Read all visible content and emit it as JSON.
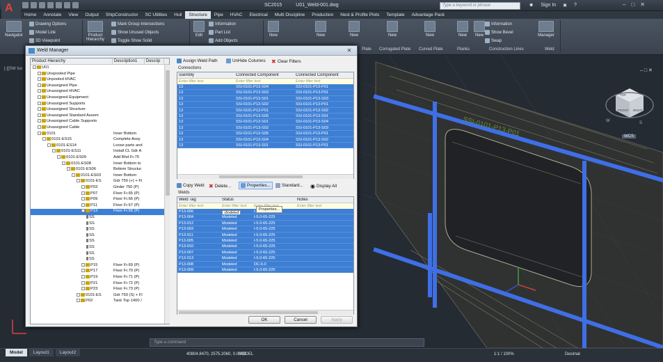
{
  "app": {
    "version_tab": "SC2015",
    "file_name": "U01_Weld-001.dwg",
    "search_placeholder": "Type a keyword or phrase",
    "sign_in": "Sign In"
  },
  "menu": [
    "Home",
    "Annotate",
    "View",
    "Output",
    "ShipConstructor",
    "SC Utilities",
    "Hull",
    "Structure",
    "Pipe",
    "HVAC",
    "Electrical",
    "Multi Discipline",
    "Production",
    "Nest & Profile Plots",
    "Template",
    "Advantage Pack"
  ],
  "menu_active_index": 7,
  "ribbon": {
    "navigator": "Navigator",
    "drawing_options": "Drawing Options",
    "model_link": "Model Link",
    "viewpoint_3d": "3D Viewpoint",
    "product": "Product",
    "hierarchy": "Hierarchy",
    "mark_group_intersections": "Mark Group Intersections",
    "show_unused_objects": "Show Unused Objects",
    "toggle_show_solid": "Toggle Show Solid",
    "edit": "Edit",
    "information": "Information",
    "part_list": "Part List",
    "add_objects": "Add Objects",
    "new": "New",
    "manager": "Manager",
    "information2": "Information",
    "show_bevel": "Show Bevel",
    "swap": "Swap",
    "panel_labels": [
      "Plate",
      "Corrugated Plate",
      "Curved Plate",
      "Planks",
      "Construction Lines",
      "Weld"
    ]
  },
  "status": {
    "tabs": [
      "Model",
      "Layout1",
      "Layout2"
    ],
    "command_placeholder": "Type a command",
    "coordinates": "40804.8470, 2575.2060, 0.0000",
    "model": "MODEL",
    "scale": "1:1 / 100%",
    "units": "Decimal"
  },
  "viewport": {
    "label": "[-][SW Iso",
    "compass_top": "TOP",
    "compass_right": "RIGHT",
    "compass_front": "FRONT",
    "compass_s": "S",
    "compass_w": "W",
    "wcs": "WCS"
  },
  "dialog": {
    "title": "Weld Manager",
    "tree_columns": [
      "Product Hierarchy",
      "Description1",
      "Descrip"
    ],
    "tree": [
      {
        "indent": 0,
        "icon": "node",
        "name": "U01",
        "desc": "",
        "sel": false
      },
      {
        "indent": 1,
        "icon": "node",
        "name": "Unspooled Pipe",
        "desc": "",
        "sel": false
      },
      {
        "indent": 1,
        "icon": "node",
        "name": "Unpooled HVAC",
        "desc": "",
        "sel": false
      },
      {
        "indent": 1,
        "icon": "node",
        "name": "Unassigned Pipe",
        "desc": "",
        "sel": false
      },
      {
        "indent": 1,
        "icon": "node",
        "name": "Unassigned HVAC",
        "desc": "",
        "sel": false
      },
      {
        "indent": 1,
        "icon": "node",
        "name": "Unassigned Equipment",
        "desc": "",
        "sel": false
      },
      {
        "indent": 1,
        "icon": "node",
        "name": "Unassigned Supports",
        "desc": "",
        "sel": false
      },
      {
        "indent": 1,
        "icon": "node",
        "name": "Unassigned Structure",
        "desc": "",
        "sel": false
      },
      {
        "indent": 1,
        "icon": "node",
        "name": "Unassigned Standard Assem",
        "desc": "",
        "sel": false
      },
      {
        "indent": 1,
        "icon": "node",
        "name": "Unassigned Cable Supports",
        "desc": "",
        "sel": false
      },
      {
        "indent": 1,
        "icon": "node",
        "name": "Unassigned Cable",
        "desc": "",
        "sel": false
      },
      {
        "indent": 1,
        "icon": "node",
        "name": "0101",
        "desc": "Inner Bottom",
        "sel": false
      },
      {
        "indent": 2,
        "icon": "node",
        "name": "0101-ES15",
        "desc": "Complete Assy",
        "sel": false
      },
      {
        "indent": 3,
        "icon": "node",
        "name": "0101-ES14",
        "desc": "Loose parts and",
        "sel": false
      },
      {
        "indent": 4,
        "icon": "node",
        "name": "0101-ES11",
        "desc": "Install CL Gdr A",
        "sel": false
      },
      {
        "indent": 5,
        "icon": "node",
        "name": "0101-ES09",
        "desc": "Add Bhd Fr.75",
        "sel": false
      },
      {
        "indent": 6,
        "icon": "node",
        "name": "0101-ES08",
        "desc": "Inner Bottom to",
        "sel": false
      },
      {
        "indent": 7,
        "icon": "node",
        "name": "0101-ES06",
        "desc": "Bottom Structur",
        "sel": false
      },
      {
        "indent": 8,
        "icon": "node",
        "name": "0101-ES03",
        "desc": "Inner Bottom",
        "sel": false
      },
      {
        "indent": 9,
        "icon": "node",
        "name": "0101-ES",
        "desc": "Gdr 750 (+) + Fl",
        "sel": false
      },
      {
        "indent": 10,
        "icon": "node",
        "name": "P03",
        "desc": "Girder 750 (P)",
        "sel": false
      },
      {
        "indent": 10,
        "icon": "node",
        "name": "P07",
        "desc": "Floor Fr.65 (P)",
        "sel": false
      },
      {
        "indent": 10,
        "icon": "node",
        "name": "P09",
        "desc": "Floor Fr.66 (P)",
        "sel": false
      },
      {
        "indent": 10,
        "icon": "node",
        "name": "P11",
        "desc": "Floor Fr.67 (P)",
        "sel": false
      },
      {
        "indent": 10,
        "icon": "node",
        "name": "P13",
        "desc": "Floor Fr.68 (P)",
        "sel": true
      },
      {
        "indent": 11,
        "icon": "bead",
        "name": "SS",
        "desc": "",
        "sel": false
      },
      {
        "indent": 11,
        "icon": "bead",
        "name": "SS",
        "desc": "",
        "sel": false
      },
      {
        "indent": 11,
        "icon": "bead",
        "name": "SS",
        "desc": "",
        "sel": false
      },
      {
        "indent": 11,
        "icon": "bead",
        "name": "SS",
        "desc": "",
        "sel": false
      },
      {
        "indent": 11,
        "icon": "bead",
        "name": "SS",
        "desc": "",
        "sel": false
      },
      {
        "indent": 11,
        "icon": "bead",
        "name": "SS",
        "desc": "",
        "sel": false
      },
      {
        "indent": 11,
        "icon": "bead",
        "name": "SS",
        "desc": "",
        "sel": false
      },
      {
        "indent": 11,
        "icon": "bead",
        "name": "SS",
        "desc": "",
        "sel": false
      },
      {
        "indent": 10,
        "icon": "node",
        "name": "P15",
        "desc": "Floor Fr.69 (P)",
        "sel": false
      },
      {
        "indent": 10,
        "icon": "node",
        "name": "P17",
        "desc": "Floor Fr.70 (P)",
        "sel": false
      },
      {
        "indent": 10,
        "icon": "node",
        "name": "P19",
        "desc": "Floor Fr.71 (P)",
        "sel": false
      },
      {
        "indent": 10,
        "icon": "node",
        "name": "P21",
        "desc": "Floor Fr.72 (P)",
        "sel": false
      },
      {
        "indent": 10,
        "icon": "node",
        "name": "P23",
        "desc": "Floor Fr.73 (P)",
        "sel": false
      },
      {
        "indent": 9,
        "icon": "node",
        "name": "0101-ES",
        "desc": "Gdr 750 (S) + Fl",
        "sel": false
      },
      {
        "indent": 9,
        "icon": "node",
        "name": "P02",
        "desc": "Tank Top 1400 /",
        "sel": false
      }
    ],
    "toolbar": {
      "assign_weld_path": "Assign Weld Path",
      "unhide_columns": "UnHide Columns",
      "clear_filters": "Clear Filters"
    },
    "connections": {
      "group_label": "Connections",
      "columns": [
        "ssembly",
        "Connected Component",
        "Connected Component"
      ],
      "filter_text": "Enter filter text",
      "rows": [
        [
          "13",
          "SSI-0101-P13-S04",
          "SSI-0101-P13-P01"
        ],
        [
          "13",
          "SSI-0101-P13-S03",
          "SSI-0101-P13-P01"
        ],
        [
          "13",
          "SSI-0101-P13-S01",
          "SSI-0101-P13-S03"
        ],
        [
          "13",
          "SSI-0101-P13-S02",
          "SSI-0101-P13-P01"
        ],
        [
          "13",
          "SSI-0101-P13-P01",
          "SSI-0101-P13-S02"
        ],
        [
          "13",
          "SSI-0101-P13-S05",
          "SSI-0101-P13-S01"
        ],
        [
          "13",
          "SSI-0101-P13-S01",
          "SSI-0101-P13-S04"
        ],
        [
          "13",
          "SSI-0101-P13-S02",
          "SSI-0101-P13-S03"
        ],
        [
          "13",
          "SSI-0101-P13-S05",
          "SSI-0101-P13-P01"
        ],
        [
          "13",
          "SSI-0101-P13-S04",
          "SSI-0101-P13-S02"
        ],
        [
          "13",
          "SSI-0101-P13-S01",
          "SSI-0101-P13-P01"
        ]
      ]
    },
    "weld_toolbar": {
      "copy_weld": "Copy Weld",
      "delete": "Delete...",
      "properties": "Properties...",
      "standard": "Standard...",
      "display_all": "Display All"
    },
    "tooltip": "Properties...",
    "welds": {
      "group_label": "Welds",
      "columns": [
        "Weld Tag",
        "Status",
        "",
        "Notes"
      ],
      "filter_text": "Enter filter text",
      "rows": [
        [
          "P13-006",
          "Modeled",
          "I-5.0-65-225",
          ""
        ],
        [
          "P13-004",
          "Modeled",
          "I-5.0-65-225",
          ""
        ],
        [
          "P13-012",
          "Modeled",
          "I-5.0-65-225",
          ""
        ],
        [
          "P13-003",
          "Modeled",
          "I-5.0-65-225",
          ""
        ],
        [
          "P13-011",
          "Modeled",
          "I-5.0-65-225",
          ""
        ],
        [
          "P13-005",
          "Modeled",
          "I-5.0-65-225",
          ""
        ],
        [
          "P13-010",
          "Modeled",
          "I-5.0-65-225",
          ""
        ],
        [
          "P13-007",
          "Modeled",
          "I-5.0-65-225",
          ""
        ],
        [
          "P13-013",
          "Modeled",
          "I-5.0-65-225",
          ""
        ],
        [
          "P13-008",
          "Modeled",
          "DC-6.0",
          ""
        ],
        [
          "P13-009",
          "Modeled",
          "I-5.0-65-225",
          ""
        ]
      ]
    },
    "ok": "OK",
    "cancel": "Cancel",
    "apply": "Apply"
  },
  "colors": {
    "selection": "#3d7fd4",
    "weld_highlight": "#3f6fe6",
    "part_green": "#6a8a3a"
  }
}
